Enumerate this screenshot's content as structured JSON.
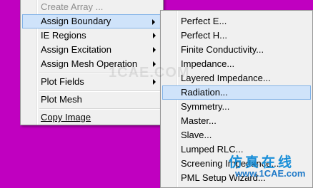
{
  "main_menu": {
    "items": [
      {
        "label": "Create Array ...",
        "disabled": true
      },
      {
        "label": "Assign Boundary",
        "has_submenu": true,
        "highlighted": true
      },
      {
        "label": "IE Regions",
        "has_submenu": true
      },
      {
        "label": "Assign Excitation",
        "has_submenu": true
      },
      {
        "label": "Assign Mesh Operation",
        "has_submenu": true
      },
      {
        "label": "Plot Fields",
        "has_submenu": true
      },
      {
        "label": "Plot Mesh"
      },
      {
        "label": "Copy Image"
      }
    ]
  },
  "boundary_submenu": {
    "items": [
      {
        "label": "Perfect E..."
      },
      {
        "label": "Perfect H..."
      },
      {
        "label": "Finite Conductivity..."
      },
      {
        "label": "Impedance..."
      },
      {
        "label": "Layered Impedance..."
      },
      {
        "label": "Radiation...",
        "highlighted": true
      },
      {
        "label": "Symmetry..."
      },
      {
        "label": "Master..."
      },
      {
        "label": "Slave..."
      },
      {
        "label": "Lumped RLC..."
      },
      {
        "label": "Screening Impedance..."
      },
      {
        "label": "PML Setup Wizard..."
      }
    ]
  },
  "watermark": {
    "center_text": "1CAE.COM",
    "logo_text": "仿真在线",
    "url_text": "www.1CAE.com"
  },
  "colors": {
    "background": "#c000c0",
    "menu_bg": "#f0f0f0",
    "highlight_bg": "#cfe3fa",
    "highlight_border": "#82b3e8"
  }
}
